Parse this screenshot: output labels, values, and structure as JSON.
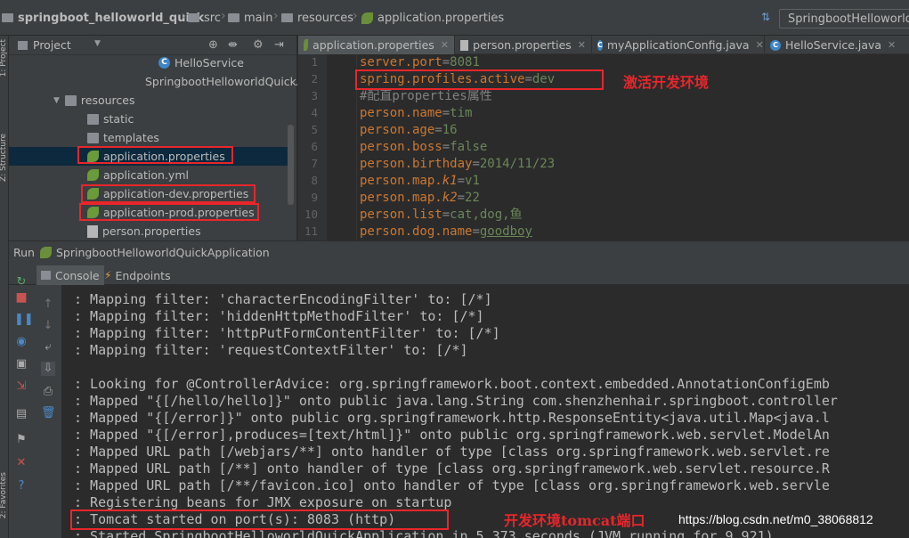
{
  "breadcrumbs": [
    {
      "label": "springboot_helloworld_quick",
      "icon": "folder-icon"
    },
    {
      "label": "src",
      "icon": "folder-icon"
    },
    {
      "label": "main",
      "icon": "folder-icon"
    },
    {
      "label": "resources",
      "icon": "folder-icon"
    },
    {
      "label": "application.properties",
      "icon": "spring-leaf-icon"
    }
  ],
  "run_config": "SpringbootHelloworldQuickApplication",
  "left_strip": {
    "tab1": "1: Project",
    "tab2": "Z: Structure",
    "tab3": "2: Favorites"
  },
  "project_panel": {
    "header": "Project",
    "tree": [
      {
        "label": "HelloService",
        "icon": "class-icon"
      },
      {
        "label": "SpringbootHelloworldQuickApplication",
        "icon": "class-icon"
      },
      {
        "label": "resources",
        "icon": "folder-icon"
      },
      {
        "label": "static",
        "icon": "folder-icon"
      },
      {
        "label": "templates",
        "icon": "folder-icon"
      },
      {
        "label": "application.properties",
        "icon": "spring-leaf-icon"
      },
      {
        "label": "application.yml",
        "icon": "spring-leaf-icon"
      },
      {
        "label": "application-dev.properties",
        "icon": "spring-leaf-icon"
      },
      {
        "label": "application-prod.properties",
        "icon": "spring-leaf-icon"
      },
      {
        "label": "person.properties",
        "icon": "properties-icon"
      }
    ]
  },
  "editor_tabs": [
    {
      "label": "application.properties",
      "icon": "spring-leaf-icon",
      "active": true
    },
    {
      "label": "person.properties",
      "icon": "properties-icon",
      "active": false
    },
    {
      "label": "myApplicationConfig.java",
      "icon": "class-icon",
      "active": false
    },
    {
      "label": "HelloService.java",
      "icon": "class-icon",
      "active": false
    }
  ],
  "code_lines": [
    {
      "n": "1",
      "key": "server.port",
      "eq": "=",
      "val": "8081"
    },
    {
      "n": "2",
      "key": "spring.profiles.active",
      "eq": "=",
      "val": "dev"
    },
    {
      "n": "3",
      "comment": "#配直properties属性"
    },
    {
      "n": "4",
      "key": "person.name",
      "eq": "=",
      "val": "tim"
    },
    {
      "n": "5",
      "key": "person.age",
      "eq": "=",
      "val": "16"
    },
    {
      "n": "6",
      "key": "person.boss",
      "eq": "=",
      "val": "false"
    },
    {
      "n": "7",
      "key": "person.birthday",
      "eq": "=",
      "val": "2014/11/23"
    },
    {
      "n": "8",
      "key_prefix": "person.map.",
      "key_italic": "k1",
      "eq": "=",
      "val": "v1"
    },
    {
      "n": "9",
      "key_prefix": "person.map.",
      "key_italic": "k2",
      "eq": "=",
      "val": "22"
    },
    {
      "n": "10",
      "key": "person.list",
      "eq": "=",
      "val": "cat,dog,鱼"
    },
    {
      "n": "11",
      "key": "person.dog.name",
      "eq": "=",
      "val": "goodboy"
    }
  ],
  "annotations": {
    "activate_dev": "激活开发环境",
    "dev_port": "开发环境tomcat端口"
  },
  "run_panel": {
    "title_prefix": "Run",
    "title": "SpringbootHelloworldQuickApplication",
    "tab_console": "Console",
    "tab_endpoints": "Endpoints"
  },
  "console_lines": [
    ": Mapping filter: 'characterEncodingFilter' to: [/*]",
    ": Mapping filter: 'hiddenHttpMethodFilter' to: [/*]",
    ": Mapping filter: 'httpPutFormContentFilter' to: [/*]",
    ": Mapping filter: 'requestContextFilter' to: [/*]",
    "",
    ": Looking for @ControllerAdvice: org.springframework.boot.context.embedded.AnnotationConfigEmb",
    ": Mapped \"{[/hello/hello]}\" onto public java.lang.String com.shenzhenhair.springboot.controller",
    ": Mapped \"{[/error]}\" onto public org.springframework.http.ResponseEntity<java.util.Map<java.l",
    ": Mapped \"{[/error],produces=[text/html]}\" onto public org.springframework.web.servlet.ModelAn",
    ": Mapped URL path [/webjars/**] onto handler of type [class org.springframework.web.servlet.re",
    ": Mapped URL path [/**] onto handler of type [class org.springframework.web.servlet.resource.R",
    ": Mapped URL path [/**/favicon.ico] onto handler of type [class org.springframework.web.servle",
    ": Registering beans for JMX exposure on startup",
    ": Tomcat started on port(s): 8083 (http)",
    ": Started SpringbootHelloworldQuickApplication in 5.373 seconds (JVM running for 9.921)"
  ],
  "watermark": "https://blog.csdn.net/m0_38068812",
  "colors": {
    "accent_red": "#e8262b",
    "keyword": "#cc7832",
    "value": "#6a8759",
    "selection": "#0d293e"
  }
}
